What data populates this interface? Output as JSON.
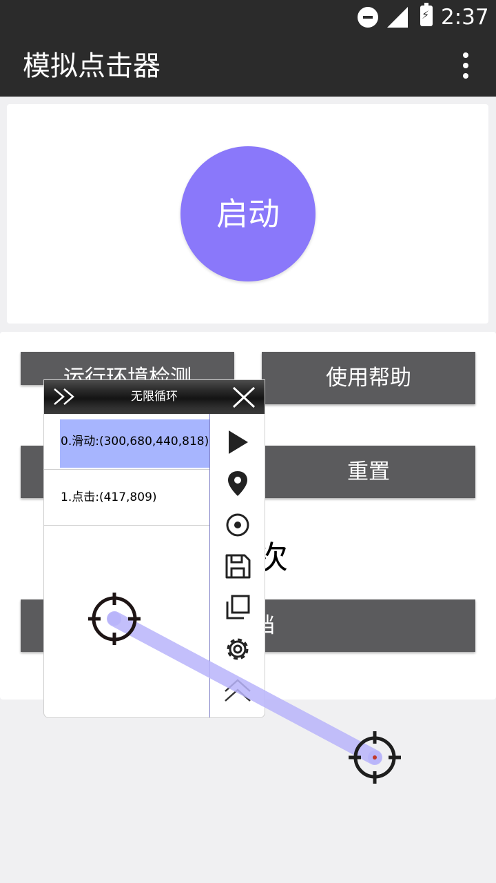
{
  "status_bar": {
    "time": "2:37",
    "icons": [
      "do-not-disturb-icon",
      "signal-icon",
      "battery-charging-icon"
    ]
  },
  "app_bar": {
    "title": "模拟点击器",
    "menu_icon": "more-vert-icon"
  },
  "main": {
    "start_button": "启动",
    "buttons": {
      "env_check": "运行环境检测",
      "help": "使用帮助",
      "reset": "重置"
    },
    "partial_text": "次",
    "partial_button_text": "档"
  },
  "float_panel": {
    "title": "无限循环",
    "items": [
      {
        "label": "0.滑动:(300,680,440,818)",
        "selected": true
      },
      {
        "label": "1.点击:(417,809)",
        "selected": false
      }
    ],
    "tools": [
      "play-icon",
      "location-pin-icon",
      "record-target-icon",
      "save-icon",
      "copy-icon",
      "settings-gear-icon",
      "collapse-up-icon"
    ]
  },
  "overlay": {
    "targets": [
      "crosshair-start-icon",
      "crosshair-end-icon"
    ],
    "swipe_color": "#b8b4fa"
  },
  "colors": {
    "bar_bg": "#2b2b2b",
    "accent": "#8a78fa",
    "button_bg": "#5b5b5d",
    "selection": "#a7b5fe",
    "page_bg": "#f0f0f2"
  }
}
